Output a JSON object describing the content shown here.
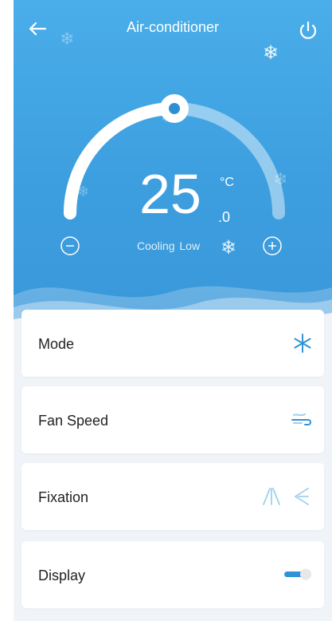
{
  "header": {
    "title": "Air-conditioner",
    "back_icon": "arrow-left-icon",
    "power_icon": "power-icon"
  },
  "thermostat": {
    "temperature": "25",
    "unit": "°C",
    "decimal": ".0",
    "mode_text": "Cooling",
    "fan_text": "Low",
    "setpoint_fraction": 0.5,
    "decrease_icon": "minus-circle-icon",
    "increase_icon": "plus-circle-icon"
  },
  "controls": [
    {
      "label": "Mode",
      "icon": "snowflake-icon"
    },
    {
      "label": "Fan Speed",
      "icon": "wind-icon"
    },
    {
      "label": "Fixation",
      "icon": "swing-direction-icon"
    },
    {
      "label": "Display",
      "icon": "toggle-switch-icon",
      "state": "on"
    }
  ],
  "colors": {
    "accent": "#2f93d6",
    "header_top": "#4aaeea",
    "header_bottom": "#3a98da",
    "icon_light": "#9fd0ef"
  }
}
